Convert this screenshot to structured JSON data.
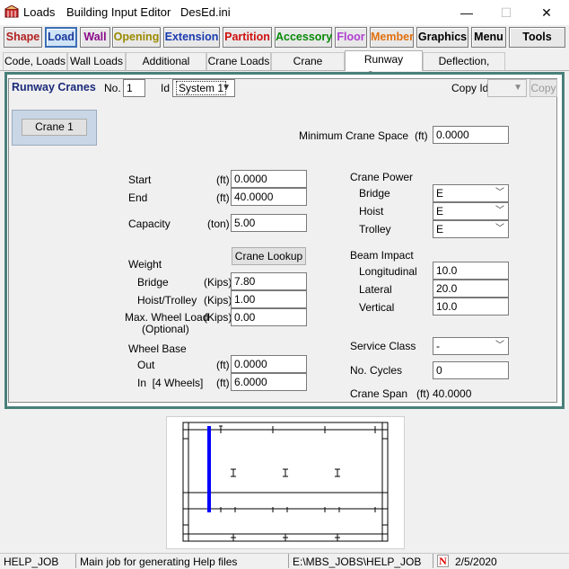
{
  "titlebar": {
    "app": "Loads",
    "editor": "Building Input Editor",
    "file": "DesEd.ini",
    "minimize": "—",
    "maximize": "☐",
    "close": "✕"
  },
  "toolbar": [
    {
      "label": "Shape",
      "color": "#b22222"
    },
    {
      "label": "Load",
      "color": "#1a3a9c"
    },
    {
      "label": "Wall",
      "color": "#8b0a8b"
    },
    {
      "label": "Opening",
      "color": "#9a8a00"
    },
    {
      "label": "Extension",
      "color": "#1a3ab0"
    },
    {
      "label": "Partition",
      "color": "#d01010"
    },
    {
      "label": "Accessory",
      "color": "#0a8a0a"
    },
    {
      "label": "Floor",
      "color": "#b040d0"
    },
    {
      "label": "Member",
      "color": "#e07010"
    },
    {
      "label": "Graphics",
      "color": "#000000"
    },
    {
      "label": "Menu",
      "color": "#000000"
    },
    {
      "label": "Tools",
      "color": "#000000"
    }
  ],
  "tabs": [
    "Code, Loads",
    "Wall Loads",
    "Additional Loads",
    "Crane Loads",
    "Crane Systems",
    "Runway Cranes",
    "Deflection, Yields"
  ],
  "active_tab": "Runway Cranes",
  "header": {
    "title": "Runway Cranes",
    "no_label": "No.",
    "no_value": "1",
    "id_label": "Id",
    "id_value": "System 1",
    "copy_id_label": "Copy Id",
    "copy_id_value": "",
    "copy_button": "Copy"
  },
  "crane_button": "Crane 1",
  "min_crane_space": {
    "label": "Minimum Crane Space",
    "unit": "(ft)",
    "value": "0.0000"
  },
  "start": {
    "label": "Start",
    "unit": "(ft)",
    "value": "0.0000"
  },
  "end": {
    "label": "End",
    "unit": "(ft)",
    "value": "40.0000"
  },
  "capacity": {
    "label": "Capacity",
    "unit": "(ton)",
    "value": "5.00"
  },
  "crane_lookup": "Crane Lookup",
  "weight": {
    "label": "Weight",
    "bridge": {
      "label": "Bridge",
      "unit": "(Kips)",
      "value": "7.80"
    },
    "hoist": {
      "label": "Hoist/Trolley",
      "unit": "(Kips)",
      "value": "1.00"
    },
    "maxwheel": {
      "label": "Max. Wheel Load",
      "unit": "(Kips)",
      "sub": "(Optional)",
      "value": "0.00"
    }
  },
  "wheelbase": {
    "label": "Wheel Base",
    "out": {
      "label": "Out",
      "unit": "(ft)",
      "value": "0.0000"
    },
    "in": {
      "label": "In  [4 Wheels]",
      "unit": "(ft)",
      "value": "6.0000"
    }
  },
  "crane_power": {
    "label": "Crane Power",
    "bridge": {
      "label": "Bridge",
      "value": "E"
    },
    "hoist": {
      "label": "Hoist",
      "value": "E"
    },
    "trolley": {
      "label": "Trolley",
      "value": "E"
    }
  },
  "beam_impact": {
    "label": "Beam Impact",
    "longitudinal": {
      "label": "Longitudinal",
      "value": "10.0"
    },
    "lateral": {
      "label": "Lateral",
      "value": "20.0"
    },
    "vertical": {
      "label": "Vertical",
      "value": "10.0"
    }
  },
  "service_class": {
    "label": "Service Class",
    "value": "-"
  },
  "no_cycles": {
    "label": "No. Cycles",
    "value": "0"
  },
  "crane_span": {
    "label": "Crane Span",
    "unit": "(ft)",
    "value": "40.0000"
  },
  "status": {
    "job": "HELP_JOB",
    "description": "Main job for generating Help files",
    "path": "E:\\MBS_JOBS\\HELP_JOB",
    "date": "2/5/2020",
    "n_icon": "N"
  }
}
